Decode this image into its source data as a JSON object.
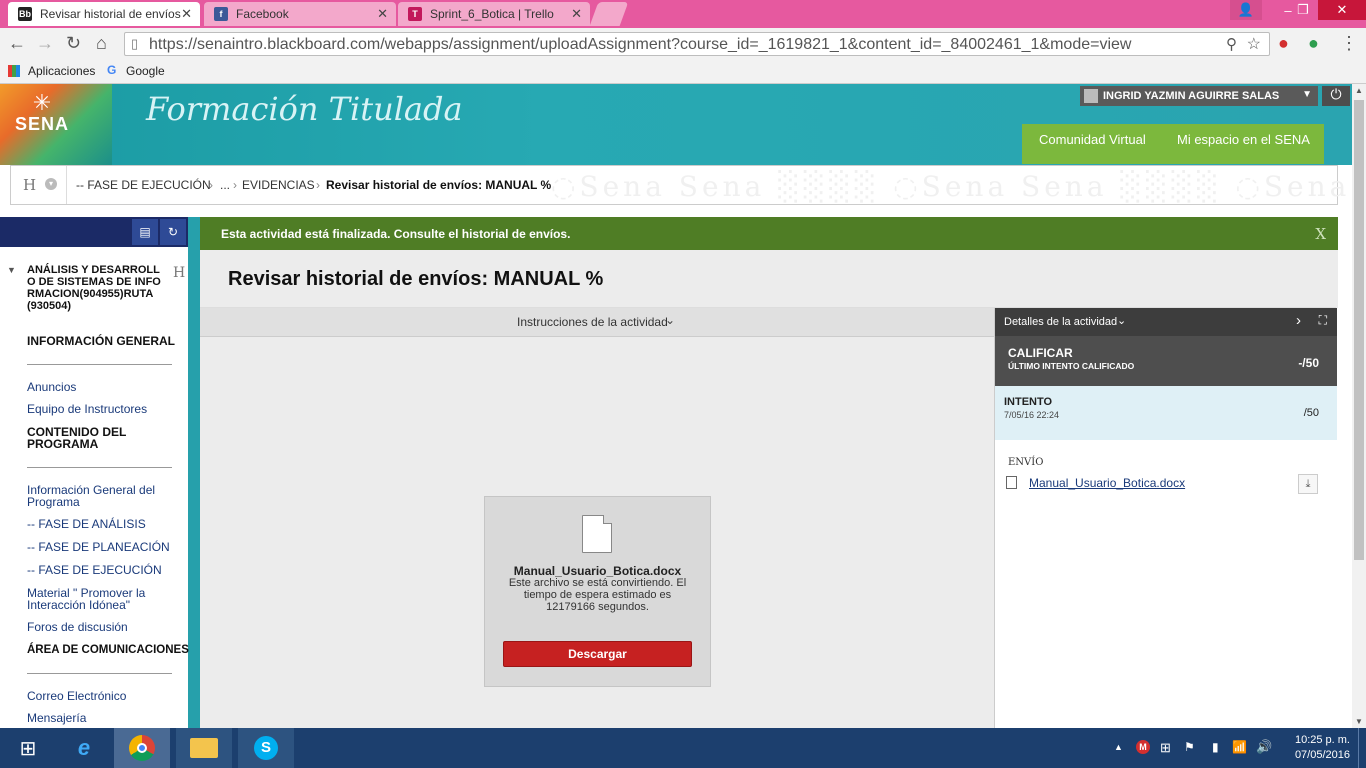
{
  "browser": {
    "tabs": [
      {
        "title": "Revisar historial de envíos",
        "favicon": "Bb"
      },
      {
        "title": "Facebook",
        "favicon": "f"
      },
      {
        "title": "Sprint_6_Botica | Trello",
        "favicon": "T"
      }
    ],
    "url": "https://senaintro.blackboard.com/webapps/assignment/uploadAssignment?course_id=_1619821_1&content_id=_84002461_1&mode=view",
    "bookmarks": [
      "Aplicaciones",
      "Google"
    ]
  },
  "header": {
    "logo_text": "SENA",
    "brand": "Formación Titulada",
    "user_name": "INGRID YAZMIN AGUIRRE SALAS",
    "nav": [
      "Comunidad Virtual",
      "Mi espacio en el SENA"
    ]
  },
  "breadcrumb": {
    "home_glyph": "H",
    "items": [
      "-- FASE DE EJECUCIÓN",
      "...",
      "EVIDENCIAS"
    ],
    "current": "Revisar historial de envíos: MANUAL %"
  },
  "leftnav": {
    "course_title": "ANÁLISIS Y DESARROLLO DE SISTEMAS DE INFORMACION(904955)RUTA(930504)",
    "collapse_glyph": "H",
    "sections": {
      "info_general": "INFORMACIÓN GENERAL",
      "anuncios": "Anuncios",
      "equipo": "Equipo de Instructores",
      "contenido": "CONTENIDO DEL PROGRAMA",
      "info_programa": "Información General del Programa",
      "fase_analisis": "-- FASE DE ANÁLISIS",
      "fase_planeacion": "-- FASE DE PLANEACIÓN",
      "fase_ejecucion": "-- FASE DE EJECUCIÓN",
      "material": "Material \" Promover la Interacción Idónea\"",
      "foros": "Foros de discusión",
      "area_com": "ÁREA DE COMUNICACIONES",
      "correo": "Correo Electrónico",
      "mensajeria": "Mensajería"
    }
  },
  "alert": {
    "text": "Esta actividad está finalizada. Consulte el historial de envíos.",
    "close": "X"
  },
  "page": {
    "title": "Revisar historial de envíos: MANUAL %",
    "instructions_label": "Instrucciones de la actividad"
  },
  "viewer": {
    "file_name": "Manual_Usuario_Botica.docx",
    "message": "Este archivo se está convirtiendo. El tiempo de espera estimado es 12179166 segundos.",
    "download_label": "Descargar"
  },
  "details": {
    "header": "Detalles de la actividad",
    "grade_label": "CALIFICAR",
    "grade_sub": "ÚLTIMO INTENTO CALIFICADO",
    "grade_value": "-/50",
    "attempt_label": "INTENTO",
    "attempt_date": "7/05/16 22:24",
    "attempt_value": "/50",
    "submission_label": "ENVÍO",
    "submission_file": "Manual_Usuario_Botica.docx"
  },
  "taskbar": {
    "time": "10:25 p. m.",
    "date": "07/05/2016"
  },
  "colors": {
    "tab_strip": "#e6599f",
    "header_teal": "#27a9b3",
    "alert_green": "#4f7d25",
    "download_red": "#c62121",
    "nav_green": "#7cb83d"
  }
}
